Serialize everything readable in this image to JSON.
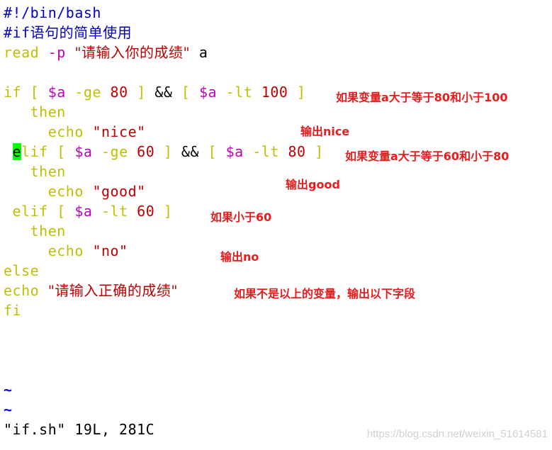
{
  "editor": {
    "shebang": "#!/bin/bash",
    "comment_prefix": "#if",
    "comment_text": "语句的简单使用",
    "read_kw": "read",
    "read_opt": "-p",
    "read_prompt": "\"请输入你的成绩\"",
    "read_var": "a",
    "if1": {
      "kw": "if",
      "lb1": "[",
      "var1": "$a",
      "op1": "-ge",
      "n1": "80",
      "rb1": "]",
      "and": "&&",
      "lb2": "[",
      "var2": "$a",
      "op2": "-lt",
      "n2": "100",
      "rb2": "]"
    },
    "then": "then",
    "echo": "echo",
    "out_nice": "\"nice\"",
    "elif1": {
      "cursor_char": "e",
      "kw_rest": "lif",
      "lb1": "[",
      "var1": "$a",
      "op1": "-ge",
      "n1": "60",
      "rb1": "]",
      "and": "&&",
      "lb2": "[",
      "var2": "$a",
      "op2": "-lt",
      "n2": "80",
      "rb2": "]"
    },
    "out_good": "\"good\"",
    "elif2": {
      "kw": "elif",
      "lb": "[",
      "var": "$a",
      "op": "-lt",
      "n": "60",
      "rb": "]"
    },
    "out_no": "\"no\"",
    "else": "else",
    "out_invalid": "\"请输入正确的成绩\"",
    "fi": "fi",
    "tilde": "~",
    "status": "\"if.sh\" 19L, 281C"
  },
  "annotations": {
    "if1": "如果变量a大于等于80和小于100",
    "nice": "输出nice",
    "elif1": "如果变量a大于等于60和小于80",
    "good": "输出good",
    "elif2": "如果小于60",
    "no": "输出no",
    "else": "如果不是以上的变量，输出以下字段"
  },
  "watermark": "https://blog.csdn.net/weixin_51614581"
}
